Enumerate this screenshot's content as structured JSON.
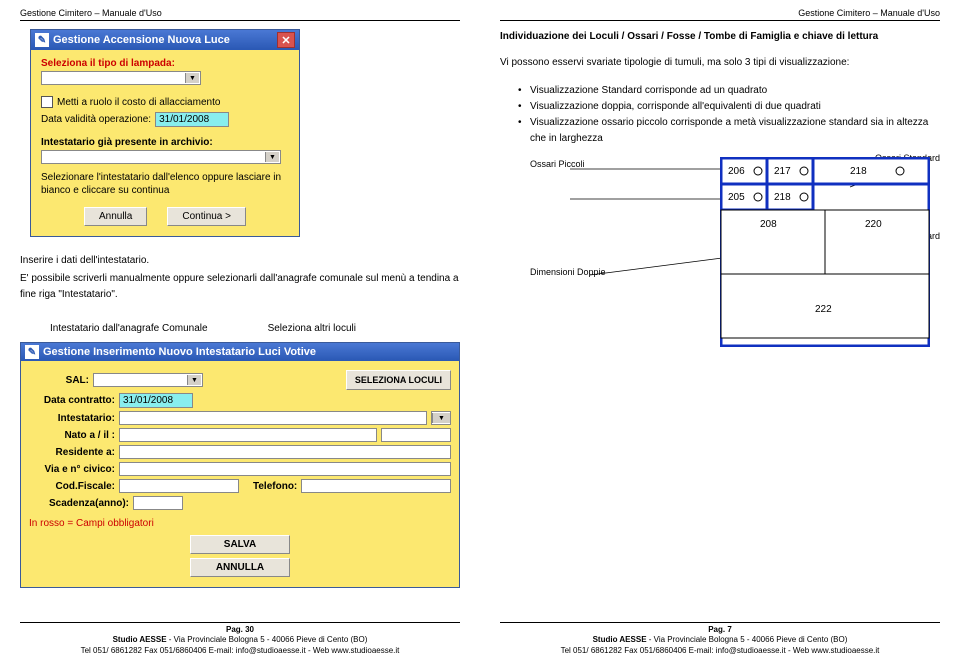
{
  "header": "Gestione Cimitero – Manuale d'Uso",
  "left": {
    "win1": {
      "title": "Gestione Accensione Nuova Luce",
      "sel_label": "Seleziona il tipo di lampada:",
      "chk_label": "Metti a ruolo il costo di allacciamento",
      "date_label": "Data validità operazione:",
      "date_value": "31/01/2008",
      "sec_label": "Intestatario già presente in archivio:",
      "note": "Selezionare l'intestatario dall'elenco oppure lasciare in bianco e cliccare su continua",
      "btn_cancel": "Annulla",
      "btn_next": "Continua >"
    },
    "t1": "Inserire i dati dell'intestatario.",
    "t2": "E' possibile scriverli manualmente oppure selezionarli dall'anagrafe comunale sul menù a tendina a fine riga \"Intestatario\".",
    "cap1": "Intestatario dall'anagrafe Comunale",
    "cap2": "Seleziona altri loculi",
    "win2": {
      "title": "Gestione Inserimento Nuovo Intestatario Luci Votive",
      "sal": "SAL:",
      "btn_sel": "SELEZIONA LOCULI",
      "f_date": "Data contratto:",
      "f_date_v": "31/01/2008",
      "f_int": "Intestatario:",
      "f_born": "Nato a / il :",
      "f_res": "Residente a:",
      "f_via": "Via e n° civico:",
      "f_cf": "Cod.Fiscale:",
      "f_tel": "Telefono:",
      "f_scad": "Scadenza(anno):",
      "red": "In rosso = Campi obbligatori",
      "btn_save": "SALVA",
      "btn_ann": "ANNULLA"
    },
    "page": "Pag. 30"
  },
  "right": {
    "h1": "Individuazione dei Loculi / Ossari / Fosse / Tombe di Famiglia e chiave di lettura",
    "p1": "Vi possono esservi svariate tipologie di tumuli, ma solo 3 tipi di visualizzazione:",
    "b1": "Visualizzazione Standard corrisponde ad un quadrato",
    "b2": "Visualizzazione doppia, corrisponde all'equivalenti di due quadrati",
    "b3": "Visualizzazione ossario piccolo corrisponde a metà visualizzazione standard sia in altezza che in larghezza",
    "lbl_op": "Ossari Piccoli",
    "lbl_os": "Ossari Standard",
    "lbl_dd": "Dimensioni Doppie",
    "lbl_ds": "Dimensioni Standard",
    "cells": {
      "c206": "206",
      "c217": "217",
      "c218": "218",
      "c205": "205",
      "c218b": "218",
      "c208": "208",
      "c220": "220",
      "c222": "222"
    },
    "page": "Pag. 7"
  },
  "footer": {
    "l1a": "Studio AESSE",
    "l1b": " - Via Provinciale Bologna 5 - 40066 Pieve di Cento (BO)",
    "l2": "Tel 051/ 6861282  Fax 051/6860406  E-mail: info@studioaesse.it  -  Web www.studioaesse.it"
  }
}
